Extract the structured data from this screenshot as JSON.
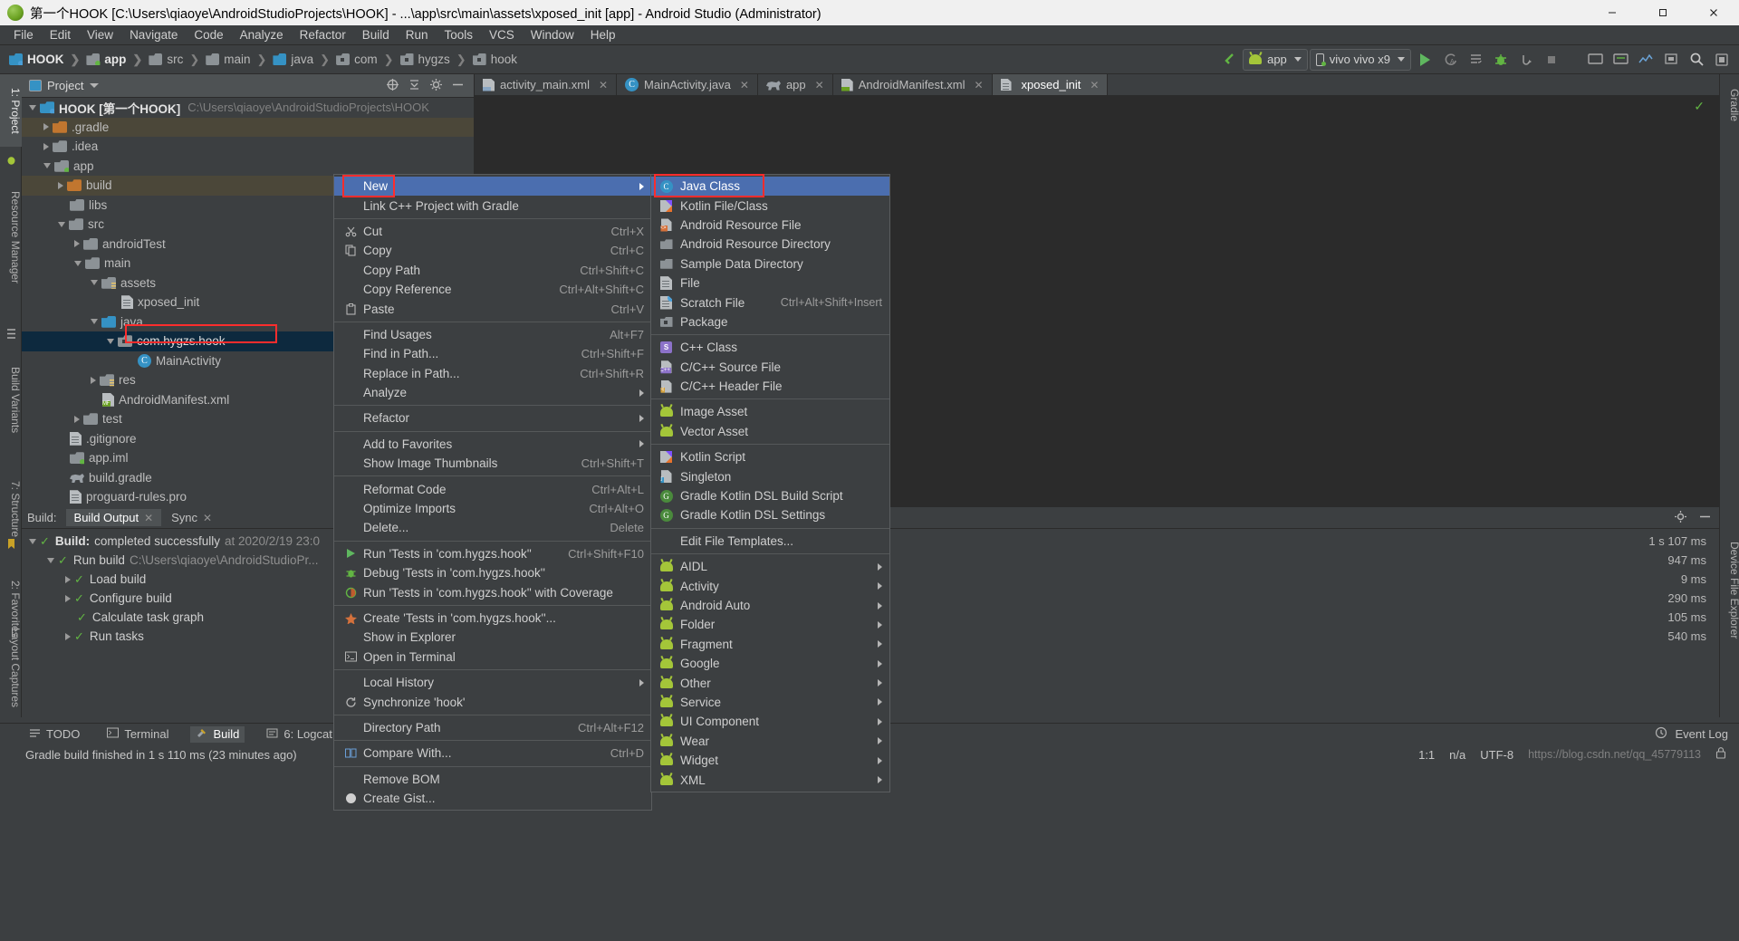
{
  "window": {
    "title": "第一个HOOK [C:\\Users\\qiaoye\\AndroidStudioProjects\\HOOK] - ...\\app\\src\\main\\assets\\xposed_init [app] - Android Studio (Administrator)",
    "minimize": "—",
    "maximize": "□",
    "close": "✕"
  },
  "menubar": [
    "File",
    "Edit",
    "View",
    "Navigate",
    "Code",
    "Analyze",
    "Refactor",
    "Build",
    "Run",
    "Tools",
    "VCS",
    "Window",
    "Help"
  ],
  "breadcrumb": [
    {
      "label": "HOOK",
      "icon": "module-folder-icon",
      "bold": true
    },
    {
      "label": "app",
      "icon": "app-folder-icon",
      "bold": true
    },
    {
      "label": "src",
      "icon": "folder-icon",
      "bold": false
    },
    {
      "label": "main",
      "icon": "folder-icon",
      "bold": false
    },
    {
      "label": "java",
      "icon": "java-folder-icon",
      "bold": false
    },
    {
      "label": "com",
      "icon": "package-icon",
      "bold": false
    },
    {
      "label": "hygzs",
      "icon": "package-icon",
      "bold": false
    },
    {
      "label": "hook",
      "icon": "package-icon",
      "bold": false
    }
  ],
  "toolbar": {
    "module_selector": "app",
    "device_selector": "vivo vivo x9",
    "run_icon": "run-icon",
    "apply_changes_icon": "apply-changes-icon",
    "debug_icon": "debug-icon",
    "search_icon": "search-icon"
  },
  "project_panel": {
    "title": "Project",
    "tree": [
      {
        "depth": 0,
        "arrow": "down",
        "icon": "module-folder-icon",
        "label": "HOOK [第一个HOOK]",
        "path": "C:\\Users\\qiaoye\\AndroidStudioProjects\\HOOK",
        "bold": true
      },
      {
        "depth": 1,
        "arrow": "right",
        "icon": "orange-folder-icon",
        "label": ".gradle",
        "highlight": "build"
      },
      {
        "depth": 1,
        "arrow": "right",
        "icon": "folder-icon",
        "label": ".idea"
      },
      {
        "depth": 1,
        "arrow": "down",
        "icon": "app-folder-icon",
        "label": "app"
      },
      {
        "depth": 2,
        "arrow": "right",
        "icon": "orange-folder-icon",
        "label": "build",
        "highlight": "build"
      },
      {
        "depth": 2,
        "arrow": "none",
        "icon": "folder-icon",
        "label": "libs"
      },
      {
        "depth": 2,
        "arrow": "down",
        "icon": "folder-icon",
        "label": "src"
      },
      {
        "depth": 3,
        "arrow": "right",
        "icon": "folder-icon",
        "label": "androidTest"
      },
      {
        "depth": 3,
        "arrow": "down",
        "icon": "folder-icon",
        "label": "main"
      },
      {
        "depth": 4,
        "arrow": "down",
        "icon": "assets-folder-icon",
        "label": "assets"
      },
      {
        "depth": 5,
        "arrow": "none",
        "icon": "file-icon",
        "label": "xposed_init"
      },
      {
        "depth": 4,
        "arrow": "down",
        "icon": "java-folder-icon",
        "label": "java"
      },
      {
        "depth": 5,
        "arrow": "down",
        "icon": "package-icon",
        "label": "com.hygzs.hook",
        "selected": true,
        "outlined": true
      },
      {
        "depth": 6,
        "arrow": "none",
        "icon": "class-icon",
        "label": "MainActivity"
      },
      {
        "depth": 4,
        "arrow": "right",
        "icon": "res-folder-icon",
        "label": "res"
      },
      {
        "depth": 4,
        "arrow": "none",
        "icon": "manifest-icon",
        "label": "AndroidManifest.xml"
      },
      {
        "depth": 3,
        "arrow": "right",
        "icon": "folder-icon",
        "label": "test"
      },
      {
        "depth": 2,
        "arrow": "none",
        "icon": "file-icon",
        "label": ".gitignore"
      },
      {
        "depth": 2,
        "arrow": "none",
        "icon": "app-folder-icon",
        "label": "app.iml"
      },
      {
        "depth": 2,
        "arrow": "none",
        "icon": "gradle-icon",
        "label": "build.gradle"
      },
      {
        "depth": 2,
        "arrow": "none",
        "icon": "file-icon",
        "label": "proguard-rules.pro"
      }
    ]
  },
  "editor_tabs": [
    {
      "label": "activity_main.xml",
      "icon": "xml-file-icon",
      "active": false
    },
    {
      "label": "MainActivity.java",
      "icon": "java-class-icon",
      "active": false
    },
    {
      "label": "app",
      "icon": "gradle-icon",
      "active": false
    },
    {
      "label": "AndroidManifest.xml",
      "icon": "manifest-icon",
      "active": false
    },
    {
      "label": "xposed_init",
      "icon": "file-icon",
      "active": true
    }
  ],
  "context_menu": {
    "items": [
      {
        "label": "New",
        "icon": "",
        "shortcut": "",
        "submenu": true,
        "selected": true,
        "outlined": true
      },
      {
        "label": "Link C++ Project with Gradle",
        "icon": "",
        "shortcut": "",
        "submenu": false
      },
      {
        "separator": true
      },
      {
        "label": "Cut",
        "icon": "scissors-icon",
        "shortcut": "Ctrl+X"
      },
      {
        "label": "Copy",
        "icon": "copy-icon",
        "shortcut": "Ctrl+C"
      },
      {
        "label": "Copy Path",
        "icon": "",
        "shortcut": "Ctrl+Shift+C"
      },
      {
        "label": "Copy Reference",
        "icon": "",
        "shortcut": "Ctrl+Alt+Shift+C"
      },
      {
        "label": "Paste",
        "icon": "clipboard-icon",
        "shortcut": "Ctrl+V"
      },
      {
        "separator": true
      },
      {
        "label": "Find Usages",
        "icon": "",
        "shortcut": "Alt+F7"
      },
      {
        "label": "Find in Path...",
        "icon": "",
        "shortcut": "Ctrl+Shift+F"
      },
      {
        "label": "Replace in Path...",
        "icon": "",
        "shortcut": "Ctrl+Shift+R"
      },
      {
        "label": "Analyze",
        "icon": "",
        "shortcut": "",
        "submenu": true
      },
      {
        "separator": true
      },
      {
        "label": "Refactor",
        "icon": "",
        "shortcut": "",
        "submenu": true
      },
      {
        "separator": true
      },
      {
        "label": "Add to Favorites",
        "icon": "",
        "shortcut": "",
        "submenu": true
      },
      {
        "label": "Show Image Thumbnails",
        "icon": "",
        "shortcut": "Ctrl+Shift+T"
      },
      {
        "separator": true
      },
      {
        "label": "Reformat Code",
        "icon": "",
        "shortcut": "Ctrl+Alt+L"
      },
      {
        "label": "Optimize Imports",
        "icon": "",
        "shortcut": "Ctrl+Alt+O"
      },
      {
        "label": "Delete...",
        "icon": "",
        "shortcut": "Delete"
      },
      {
        "separator": true
      },
      {
        "label": "Run 'Tests in 'com.hygzs.hook''",
        "icon": "run-icon",
        "shortcut": "Ctrl+Shift+F10"
      },
      {
        "label": "Debug 'Tests in 'com.hygzs.hook''",
        "icon": "debug-icon",
        "shortcut": ""
      },
      {
        "label": "Run 'Tests in 'com.hygzs.hook'' with Coverage",
        "icon": "coverage-icon",
        "shortcut": ""
      },
      {
        "separator": true
      },
      {
        "label": "Create 'Tests in 'com.hygzs.hook''...",
        "icon": "create-run-config-icon",
        "shortcut": ""
      },
      {
        "label": "Show in Explorer",
        "icon": "",
        "shortcut": ""
      },
      {
        "label": "Open in Terminal",
        "icon": "terminal-icon",
        "shortcut": ""
      },
      {
        "separator": true
      },
      {
        "label": "Local History",
        "icon": "",
        "shortcut": "",
        "submenu": true
      },
      {
        "label": "Synchronize 'hook'",
        "icon": "refresh-icon",
        "shortcut": ""
      },
      {
        "separator": true
      },
      {
        "label": "Directory Path",
        "icon": "",
        "shortcut": "Ctrl+Alt+F12"
      },
      {
        "separator": true
      },
      {
        "label": "Compare With...",
        "icon": "compare-icon",
        "shortcut": "Ctrl+D"
      },
      {
        "separator": true
      },
      {
        "label": "Remove BOM",
        "icon": "",
        "shortcut": ""
      },
      {
        "label": "Create Gist...",
        "icon": "github-icon",
        "shortcut": ""
      }
    ]
  },
  "new_submenu": {
    "items": [
      {
        "label": "Java Class",
        "icon": "java-class-icon",
        "selected": true,
        "outlined": true
      },
      {
        "label": "Kotlin File/Class",
        "icon": "kotlin-icon"
      },
      {
        "label": "Android Resource File",
        "icon": "android-resource-file-icon"
      },
      {
        "label": "Android Resource Directory",
        "icon": "folder-icon"
      },
      {
        "label": "Sample Data Directory",
        "icon": "folder-icon"
      },
      {
        "label": "File",
        "icon": "file-icon"
      },
      {
        "label": "Scratch File",
        "icon": "scratch-file-icon",
        "shortcut": "Ctrl+Alt+Shift+Insert"
      },
      {
        "label": "Package",
        "icon": "package-icon"
      },
      {
        "separator": true
      },
      {
        "label": "C++ Class",
        "icon": "cpp-class-icon"
      },
      {
        "label": "C/C++ Source File",
        "icon": "cpp-source-icon"
      },
      {
        "label": "C/C++ Header File",
        "icon": "cpp-header-icon"
      },
      {
        "separator": true
      },
      {
        "label": "Image Asset",
        "icon": "android-icon"
      },
      {
        "label": "Vector Asset",
        "icon": "android-icon"
      },
      {
        "separator": true
      },
      {
        "label": "Kotlin Script",
        "icon": "kotlin-script-icon"
      },
      {
        "label": "Singleton",
        "icon": "java-file-icon"
      },
      {
        "label": "Gradle Kotlin DSL Build Script",
        "icon": "gradle-g-icon"
      },
      {
        "label": "Gradle Kotlin DSL Settings",
        "icon": "gradle-g-icon"
      },
      {
        "separator": true
      },
      {
        "label": "Edit File Templates...",
        "icon": ""
      },
      {
        "separator": true
      },
      {
        "label": "AIDL",
        "icon": "android-icon",
        "submenu": true
      },
      {
        "label": "Activity",
        "icon": "android-icon",
        "submenu": true
      },
      {
        "label": "Android Auto",
        "icon": "android-icon",
        "submenu": true
      },
      {
        "label": "Folder",
        "icon": "android-icon",
        "submenu": true
      },
      {
        "label": "Fragment",
        "icon": "android-icon",
        "submenu": true
      },
      {
        "label": "Google",
        "icon": "android-icon",
        "submenu": true
      },
      {
        "label": "Other",
        "icon": "android-icon",
        "submenu": true
      },
      {
        "label": "Service",
        "icon": "android-icon",
        "submenu": true
      },
      {
        "label": "UI Component",
        "icon": "android-icon",
        "submenu": true
      },
      {
        "label": "Wear",
        "icon": "android-icon",
        "submenu": true
      },
      {
        "label": "Widget",
        "icon": "android-icon",
        "submenu": true
      },
      {
        "label": "XML",
        "icon": "android-icon",
        "submenu": true
      }
    ]
  },
  "build_panel": {
    "label": "Build:",
    "tabs": [
      {
        "label": "Build Output",
        "active": true,
        "closable": true
      },
      {
        "label": "Sync",
        "active": false,
        "closable": true
      }
    ],
    "rows": [
      {
        "depth": 0,
        "arrow": "down",
        "check": true,
        "label": "Build:",
        "rest": "completed successfully",
        "dim": "at 2020/2/19 23:0",
        "time": "1 s 107 ms"
      },
      {
        "depth": 1,
        "arrow": "down",
        "check": true,
        "label": "Run build",
        "rest": "",
        "dim": "C:\\Users\\qiaoye\\AndroidStudioPr...",
        "time": "947 ms"
      },
      {
        "depth": 2,
        "arrow": "right",
        "check": true,
        "label": "Load build",
        "rest": "",
        "dim": "",
        "time": "9 ms"
      },
      {
        "depth": 2,
        "arrow": "right",
        "check": true,
        "label": "Configure build",
        "rest": "",
        "dim": "",
        "time": "290 ms"
      },
      {
        "depth": 2,
        "arrow": "none",
        "check": true,
        "label": "Calculate task graph",
        "rest": "",
        "dim": "",
        "time": "105 ms"
      },
      {
        "depth": 2,
        "arrow": "right",
        "check": true,
        "label": "Run tasks",
        "rest": "",
        "dim": "",
        "time": "540 ms"
      }
    ]
  },
  "left_strip": [
    {
      "label": "1: Project",
      "selected": true
    },
    {
      "label": "Resource Manager",
      "selected": false
    },
    {
      "label": "Build Variants",
      "selected": false
    },
    {
      "label": "7: Structure",
      "selected": false
    },
    {
      "label": "2: Favorites",
      "selected": false
    },
    {
      "label": "Layout Captures",
      "selected": false
    }
  ],
  "right_strip": [
    {
      "label": "Gradle"
    },
    {
      "label": "Device File Explorer"
    }
  ],
  "bottom_bar": {
    "items": [
      {
        "label": "TODO",
        "icon": "todo-icon"
      },
      {
        "label": "Terminal",
        "icon": "terminal-icon"
      },
      {
        "label": "Build",
        "icon": "build-icon",
        "active": true
      },
      {
        "label": "6: Logcat",
        "icon": "logcat-icon"
      }
    ],
    "event_log": "Event Log"
  },
  "status_bar": {
    "message": "Gradle build finished in 1 s 110 ms (23 minutes ago)",
    "caret": "1:1",
    "line_sep": "n/a",
    "encoding": "UTF-8",
    "watermark": "https://blog.csdn.net/qq_45779113"
  }
}
